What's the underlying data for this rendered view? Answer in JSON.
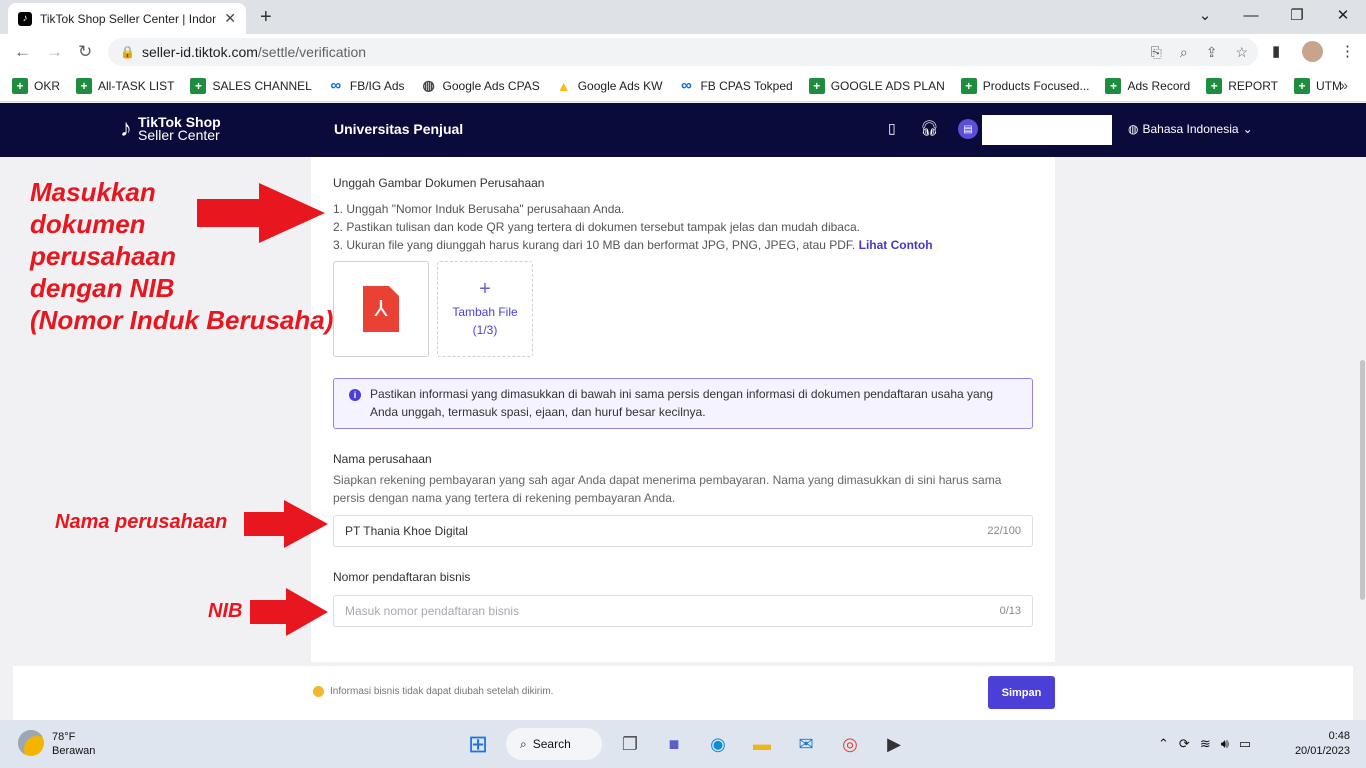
{
  "browser": {
    "tab_title": "TikTok Shop Seller Center | Indonesia",
    "url_host": "seller-id.tiktok.com",
    "url_path": "/settle/verification",
    "bookmarks": [
      {
        "label": "OKR",
        "icon": "sheets-icon"
      },
      {
        "label": "All-TASK LIST",
        "icon": "sheets-icon"
      },
      {
        "label": "SALES CHANNEL",
        "icon": "sheets-icon"
      },
      {
        "label": "FB/IG Ads",
        "icon": "meta-icon"
      },
      {
        "label": "Google Ads CPAS",
        "icon": "globe-icon"
      },
      {
        "label": "Google Ads KW",
        "icon": "google-ads-icon"
      },
      {
        "label": "FB CPAS Tokped",
        "icon": "meta-icon"
      },
      {
        "label": "GOOGLE ADS PLAN",
        "icon": "sheets-icon"
      },
      {
        "label": "Products Focused...",
        "icon": "sheets-icon"
      },
      {
        "label": "Ads Record",
        "icon": "sheets-icon"
      },
      {
        "label": "REPORT",
        "icon": "sheets-icon"
      },
      {
        "label": "UTM",
        "icon": "sheets-icon"
      }
    ]
  },
  "header": {
    "logo_top": "TikTok Shop",
    "logo_bottom": "Seller Center",
    "university": "Universitas Penjual",
    "language": "Bahasa Indonesia"
  },
  "upload": {
    "title": "Unggah Gambar Dokumen Perusahaan",
    "step1": "1. Unggah \"Nomor Induk Berusaha\" perusahaan Anda.",
    "step2": "2. Pastikan tulisan dan kode QR yang tertera di dokumen tersebut tampak jelas dan mudah dibaca.",
    "step3": "3. Ukuran file yang diunggah harus kurang dari 10 MB dan berformat JPG, PNG, JPEG, atau PDF.",
    "example_link": "Lihat Contoh",
    "add_file_label": "Tambah File",
    "add_file_count": "(1/3)"
  },
  "info_notice": "Pastikan informasi yang dimasukkan di bawah ini sama persis dengan informasi di dokumen pendaftaran usaha yang Anda unggah, termasuk spasi, ejaan, dan huruf besar kecilnya.",
  "company": {
    "label": "Nama perusahaan",
    "description": "Siapkan rekening pembayaran yang sah agar Anda dapat menerima pembayaran. Nama yang dimasukkan di sini harus sama persis dengan nama yang tertera di rekening pembayaran Anda.",
    "value": "PT Thania Khoe Digital",
    "counter": "22/100"
  },
  "nib": {
    "label": "Nomor pendaftaran bisnis",
    "placeholder": "Masuk nomor pendaftaran bisnis",
    "counter": "0/13"
  },
  "footer": {
    "warning": "Informasi bisnis tidak dapat diubah setelah dikirim.",
    "save_label": "Simpan"
  },
  "annotations": {
    "a1": [
      "Masukkan",
      "dokumen",
      "perusahaan",
      "dengan NIB",
      "(Nomor Induk Berusaha)"
    ],
    "a2": "Nama perusahaan",
    "a3": "NIB",
    "color": "#e8161e"
  },
  "taskbar": {
    "temp": "78°F",
    "weather": "Berawan",
    "search": "Search",
    "time": "0:48",
    "date": "20/01/2023"
  },
  "colors": {
    "header_bg": "#0b0b3b",
    "accent": "#4b3fd8"
  }
}
